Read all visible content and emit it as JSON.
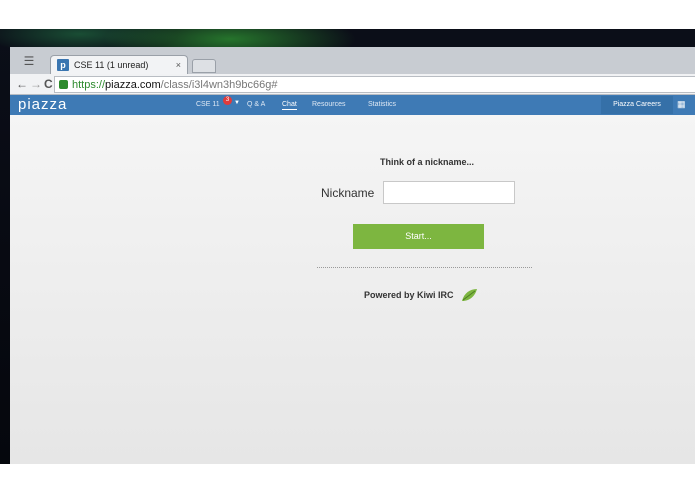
{
  "browser": {
    "tab_title": "CSE 11 (1 unread)",
    "tab_close": "×",
    "favicon_letter": "p",
    "url_scheme": "https://",
    "url_host": "piazza.com",
    "url_path": "/class/i3l4wn3h9bc66g#",
    "back": "←",
    "forward": "→",
    "reload": "C"
  },
  "piazza": {
    "logo": "piazza",
    "nav": {
      "class": "CSE 11",
      "badge": "3",
      "qa": "Q & A",
      "chat": "Chat",
      "resources": "Resources",
      "statistics": "Statistics",
      "careers": "Piazza Careers"
    }
  },
  "chat": {
    "prompt": "Think of a nickname...",
    "nickname_label": "Nickname",
    "nickname_value": "",
    "start_label": "Start...",
    "powered_by": "Powered by Kiwi IRC"
  },
  "colors": {
    "nav_bg": "#3e7ab5",
    "start_button": "#7db640",
    "badge": "#e13b3b"
  }
}
